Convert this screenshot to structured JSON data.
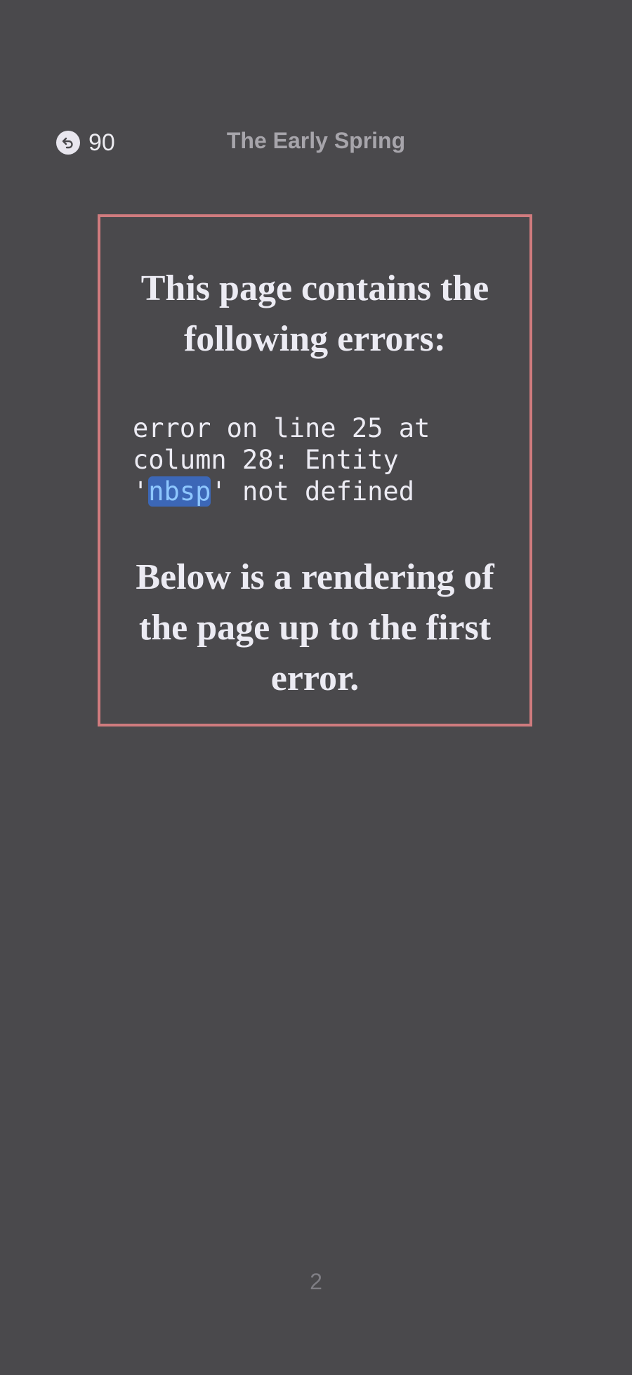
{
  "header": {
    "back_count": "90",
    "book_title": "The Early Spring"
  },
  "error_box": {
    "heading": "This page contains the following errors:",
    "message_prefix": "error on line 25 at column 28: Entity '",
    "message_highlight": "nbsp",
    "message_suffix": "' not defined",
    "footer": "Below is a rendering of the page up to the first error."
  },
  "page_number": "2",
  "colors": {
    "background": "#4a494c",
    "border": "#d07b7e",
    "highlight_bg": "#3c67b7",
    "highlight_text": "#8ec7ff"
  },
  "icons": {
    "back": "back-arrow-icon"
  }
}
